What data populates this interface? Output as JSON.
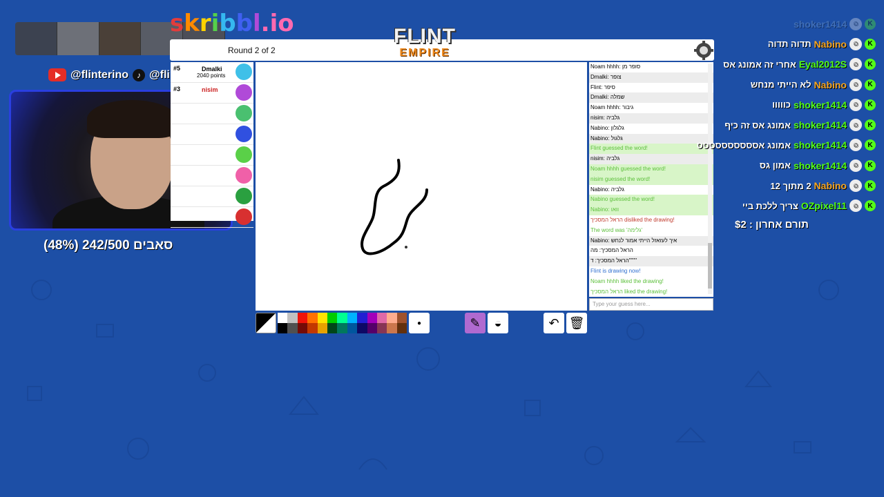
{
  "social": {
    "youtube": "@flinterino",
    "tiktok": "@flintprime"
  },
  "subs_goal": "סאבים 242/500 (48%)",
  "logo": {
    "text": "skribbl.io",
    "brand_top": "FLINT",
    "brand_bottom": "EMPIRE"
  },
  "game": {
    "round_text": "Round 2 of 2",
    "players": [
      {
        "rank": "#5",
        "name": "Dmalki",
        "points": "2040 points",
        "color": "#3fc0e8"
      },
      {
        "rank": "#3",
        "name": "nisim",
        "points": "",
        "color": "#b04ad8"
      },
      {
        "rank": "",
        "name": "",
        "points": "",
        "color": "#4ac070"
      },
      {
        "rank": "",
        "name": "",
        "points": "",
        "color": "#3050e0"
      },
      {
        "rank": "",
        "name": "",
        "points": "",
        "color": "#5ad048"
      },
      {
        "rank": "",
        "name": "",
        "points": "",
        "color": "#f060a8"
      },
      {
        "rank": "",
        "name": "",
        "points": "",
        "color": "#2aa040"
      },
      {
        "rank": "",
        "name": "",
        "points": "",
        "color": "#d83030"
      }
    ],
    "chat": [
      {
        "text": "Noam hhhh: סופר מן",
        "type": ""
      },
      {
        "text": "Dmalki: צופר",
        "type": ""
      },
      {
        "text": "Flint: סיפר",
        "type": ""
      },
      {
        "text": "Dmalki: שמלה",
        "type": ""
      },
      {
        "text": "Noam hhhh: גיבור",
        "type": ""
      },
      {
        "text": "nisim: גלביה",
        "type": ""
      },
      {
        "text": "Nabino: גלגלון",
        "type": ""
      },
      {
        "text": "Nabino: גלגול",
        "type": ""
      },
      {
        "text": "Flint guessed the word!",
        "type": "g"
      },
      {
        "text": "nisim: גלביה",
        "type": ""
      },
      {
        "text": "Noam hhhh guessed the word!",
        "type": "g"
      },
      {
        "text": "nisim guessed the word!",
        "type": "g"
      },
      {
        "text": "Nabino: גלביה",
        "type": ""
      },
      {
        "text": "Nabino guessed the word!",
        "type": "g"
      },
      {
        "text": "Nabino: וואו",
        "type": "g"
      },
      {
        "text": "הראל המסכיך disliked the drawing!",
        "type": "r"
      },
      {
        "text": "The word was 'גלימה'",
        "type": "gt"
      },
      {
        "text": "Nabino: איך לעזאזל הייתי אמור לנחש",
        "type": ""
      },
      {
        "text": "הראל המסכיך: מה",
        "type": ""
      },
      {
        "text": "הראל המסכיך: ד\"\"\"\"",
        "type": ""
      },
      {
        "text": "Flint is drawing now!",
        "type": "b"
      },
      {
        "text": "Noam hhhh liked the drawing!",
        "type": "gt"
      },
      {
        "text": "הראל המסכיך liked the drawing!",
        "type": "gt"
      }
    ],
    "chat_placeholder": "Type your guess here...",
    "palette": [
      "#ffffff",
      "#c1c1c1",
      "#ef130b",
      "#ff7100",
      "#ffe400",
      "#00cc00",
      "#00ff91",
      "#00b2ff",
      "#231fd3",
      "#a300ba",
      "#df69a7",
      "#ffac8e",
      "#a0522d",
      "#000000",
      "#505050",
      "#740b07",
      "#c23800",
      "#e8a200",
      "#004619",
      "#00785d",
      "#00569e",
      "#0e0865",
      "#550069",
      "#873554",
      "#cc774d",
      "#63300d"
    ]
  },
  "stream_chat": [
    {
      "msg": "",
      "user": "shoker1414",
      "color": "#7fa8d8",
      "faded": true
    },
    {
      "msg": "תדוה תדוה",
      "user": "Nabino",
      "color": "#f5a623"
    },
    {
      "msg": "אחרי זה אמונג אס",
      "user": "Eyal2012S",
      "color": "#53fc18"
    },
    {
      "msg": "לא הייתי מנחש",
      "user": "Nabino",
      "color": "#f5a623"
    },
    {
      "msg": "כווווו",
      "user": "shoker1414",
      "color": "#53fc18"
    },
    {
      "msg": "אמונג אס זה כיף",
      "user": "shoker1414",
      "color": "#53fc18"
    },
    {
      "msg": "אמונג אסססססססססס",
      "user": "shoker1414",
      "color": "#53fc18"
    },
    {
      "msg": "אמון גס",
      "user": "shoker1414",
      "color": "#53fc18"
    },
    {
      "msg": "2 מתוך 12",
      "user": "Nabino",
      "color": "#f5a623"
    },
    {
      "msg": "צריך ללכת ביי",
      "user": "OZpixel11",
      "color": "#53fc18"
    }
  ],
  "last_donation": "תורם אחרון : $2"
}
